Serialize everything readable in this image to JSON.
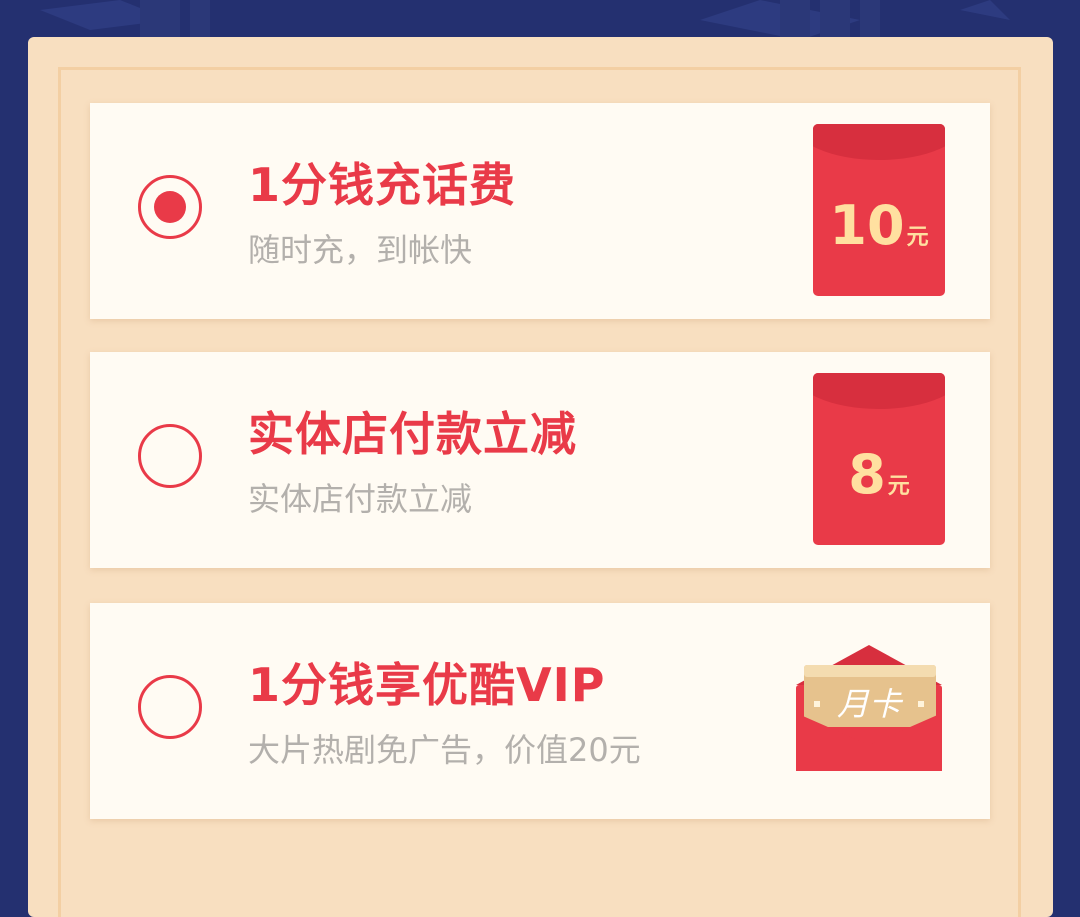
{
  "options": [
    {
      "title": "1分钱充话费",
      "subtitle": "随时充，到帐快",
      "selected": true,
      "reward": {
        "amount": "10",
        "unit": "元"
      }
    },
    {
      "title": "实体店付款立减",
      "subtitle": "实体店付款立减",
      "selected": false,
      "reward": {
        "amount": "8",
        "unit": "元"
      }
    },
    {
      "title": "1分钱享优酷VIP",
      "subtitle": "大片热剧免广告，价值20元",
      "selected": false,
      "reward": {
        "card_label": "月卡"
      }
    }
  ],
  "colors": {
    "background": "#243070",
    "panel": "#f8dfc0",
    "card": "#fffbf3",
    "accent_red": "#e93a48",
    "gold_text": "#ffe0a0",
    "muted_text": "#b3b0ac"
  }
}
